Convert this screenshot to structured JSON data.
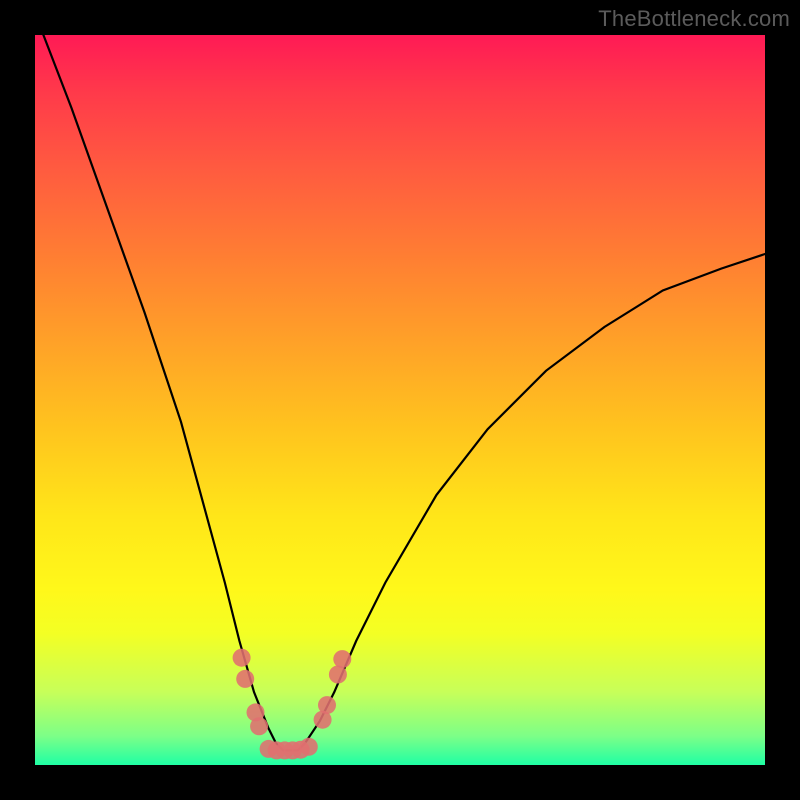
{
  "watermark": "TheBottleneck.com",
  "chart_data": {
    "type": "line",
    "title": "",
    "xlabel": "",
    "ylabel": "",
    "xlim": [
      0,
      100
    ],
    "ylim": [
      0,
      100
    ],
    "series": [
      {
        "name": "bottleneck-curve",
        "x": [
          0,
          5,
          10,
          15,
          20,
          23,
          26,
          28,
          30,
          32,
          33,
          34,
          35,
          36,
          37,
          39,
          41,
          44,
          48,
          55,
          62,
          70,
          78,
          86,
          94,
          100
        ],
        "values": [
          103,
          90,
          76,
          62,
          47,
          36,
          25,
          17,
          10,
          5,
          3,
          2,
          2,
          2,
          3,
          6,
          10,
          17,
          25,
          37,
          46,
          54,
          60,
          65,
          68,
          70
        ]
      }
    ],
    "markers": {
      "name": "highlight-points",
      "color": "#e07070",
      "points": [
        {
          "x": 28.3,
          "y": 14.7
        },
        {
          "x": 28.8,
          "y": 11.8
        },
        {
          "x": 30.2,
          "y": 7.2
        },
        {
          "x": 30.7,
          "y": 5.3
        },
        {
          "x": 32.0,
          "y": 2.2
        },
        {
          "x": 33.1,
          "y": 2.0
        },
        {
          "x": 34.2,
          "y": 2.0
        },
        {
          "x": 35.3,
          "y": 2.0
        },
        {
          "x": 36.4,
          "y": 2.1
        },
        {
          "x": 37.5,
          "y": 2.5
        },
        {
          "x": 39.4,
          "y": 6.2
        },
        {
          "x": 40.0,
          "y": 8.2
        },
        {
          "x": 41.5,
          "y": 12.4
        },
        {
          "x": 42.1,
          "y": 14.5
        }
      ]
    },
    "gradient_stops": [
      {
        "pos": 0,
        "color": "#ff1a55"
      },
      {
        "pos": 30,
        "color": "#ff7d33"
      },
      {
        "pos": 66,
        "color": "#ffe619"
      },
      {
        "pos": 100,
        "color": "#1fffa4"
      }
    ]
  }
}
